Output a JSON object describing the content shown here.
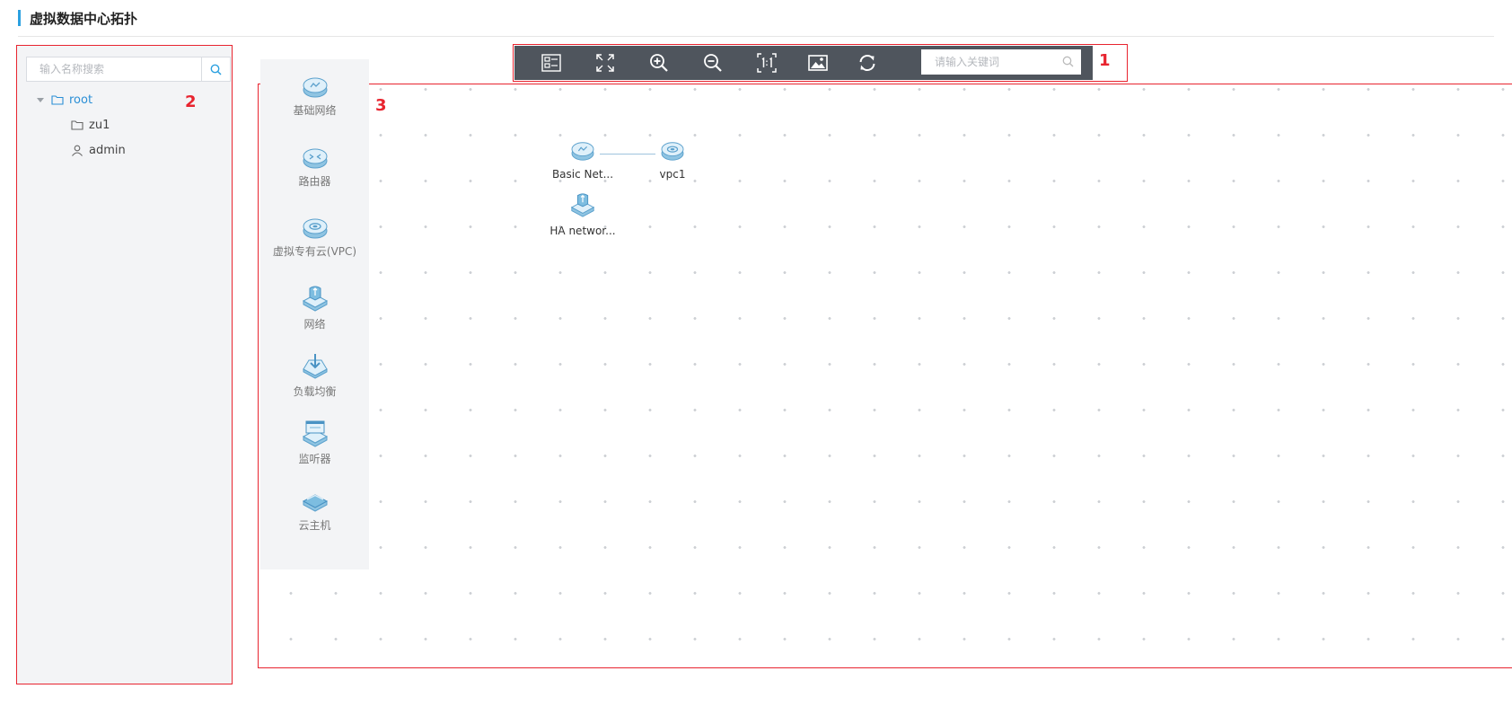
{
  "page": {
    "title": "虚拟数据中心拓扑"
  },
  "left_panel": {
    "search_placeholder": "输入名称搜索",
    "tree": [
      {
        "label": "root",
        "icon": "folder-icon",
        "expanded": true
      },
      {
        "label": "zu1",
        "icon": "folder-icon"
      },
      {
        "label": "admin",
        "icon": "user-icon"
      }
    ],
    "number": "2"
  },
  "toolbar": {
    "buttons": [
      {
        "name": "overview",
        "icon": "overview-icon"
      },
      {
        "name": "fullscreen",
        "icon": "fullscreen-icon"
      },
      {
        "name": "zoom-in",
        "icon": "zoom-in-icon"
      },
      {
        "name": "zoom-out",
        "icon": "zoom-out-icon"
      },
      {
        "name": "actual-size",
        "icon": "one-to-one-icon"
      },
      {
        "name": "export-image",
        "icon": "image-icon"
      },
      {
        "name": "refresh",
        "icon": "refresh-icon"
      }
    ],
    "search_placeholder": "请输入关键词",
    "number": "1"
  },
  "canvas": {
    "number": "3",
    "palette": [
      {
        "label": "基础网络",
        "icon": "basic-network-icon"
      },
      {
        "label": "路由器",
        "icon": "router-icon"
      },
      {
        "label": "虚拟专有云(VPC)",
        "icon": "vpc-icon"
      },
      {
        "label": "网络",
        "icon": "network-icon"
      },
      {
        "label": "负载均衡",
        "icon": "load-balancer-icon"
      },
      {
        "label": "监听器",
        "icon": "listener-icon"
      },
      {
        "label": "云主机",
        "icon": "cloud-host-icon"
      }
    ],
    "nodes": [
      {
        "label": "Basic Net...",
        "icon": "basic-network-icon"
      },
      {
        "label": "vpc1",
        "icon": "vpc-icon"
      },
      {
        "label": "HA networ...",
        "icon": "network-icon"
      }
    ]
  },
  "colors": {
    "accent": "#2ba0e0",
    "annotation": "#e8242f",
    "toolbar_bg": "#4f555d",
    "panel_bg": "#f3f4f6"
  }
}
